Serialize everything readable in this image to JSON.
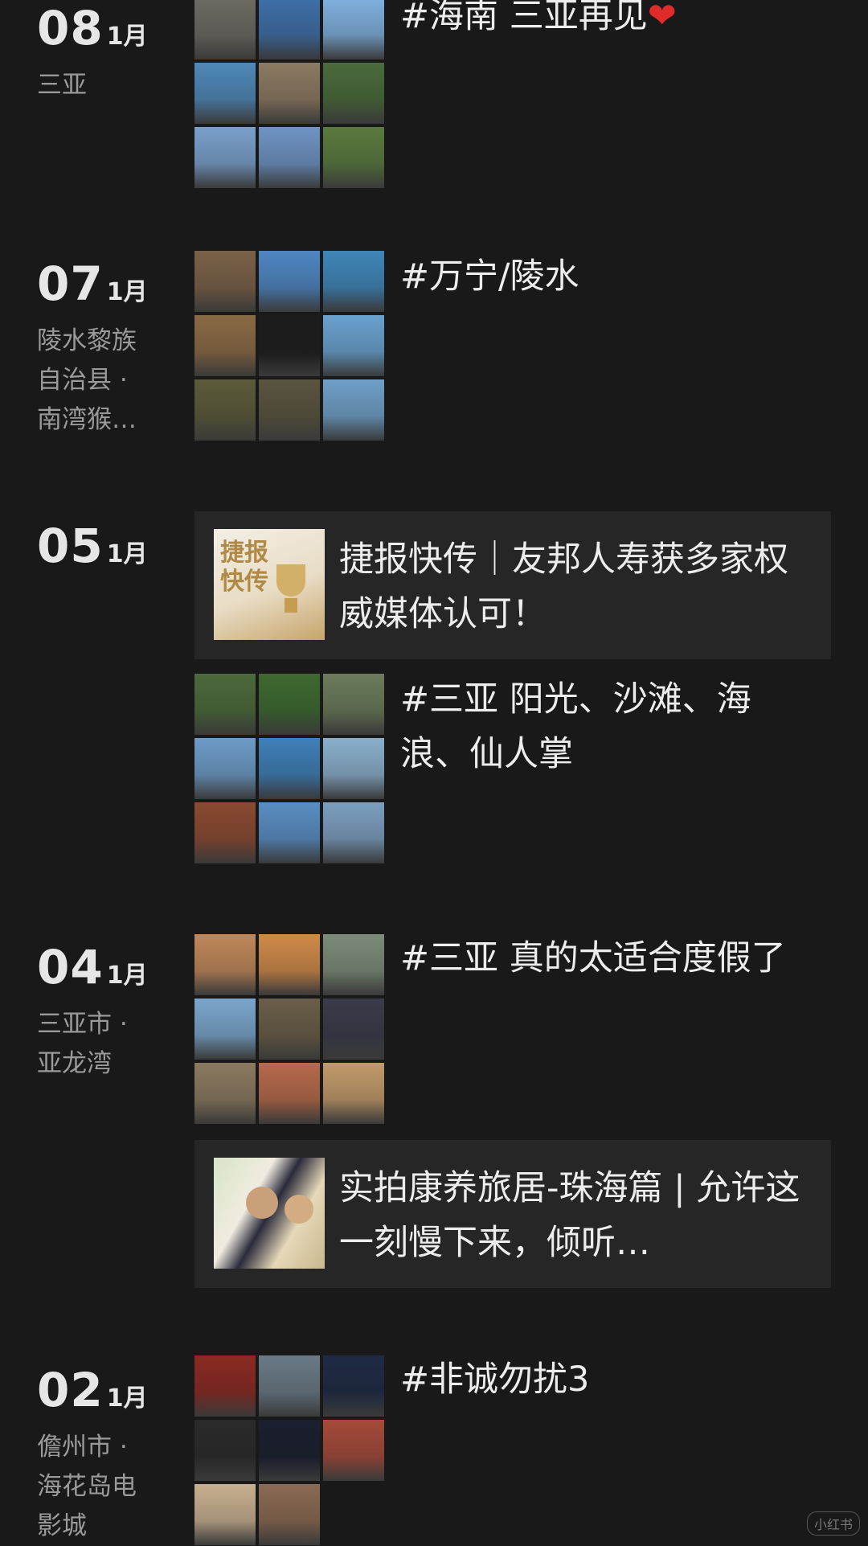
{
  "colors": {
    "background": "#191919",
    "card": "#262626",
    "text": "#ededed",
    "muted": "#9a9a9a",
    "heart": "#e02b2b"
  },
  "entries": [
    {
      "day": "08",
      "month": "1月",
      "location": "三亚",
      "caption": "#海南 三亚再见",
      "heart": "❤"
    },
    {
      "day": "07",
      "month": "1月",
      "location": "陵水黎族自治县 · 南湾猴…",
      "caption": "#万宁/陵水"
    },
    {
      "day": "05",
      "month": "1月",
      "location": "",
      "link_title": "捷报快传｜友邦人寿获多家权威媒体认可！",
      "link_thumb_text": "捷报快传",
      "caption": "#三亚 阳光、沙滩、海浪、仙人掌"
    },
    {
      "day": "04",
      "month": "1月",
      "location": "三亚市 · 亚龙湾",
      "caption": "#三亚 真的太适合度假了",
      "link_title": "实拍康养旅居-珠海篇 | 允许这一刻慢下来，倾听…"
    },
    {
      "day": "02",
      "month": "1月",
      "location": "儋州市 · 海花岛电影城",
      "caption": "#非诚勿扰3"
    }
  ],
  "grid_colors": [
    [
      "#6d6a63",
      "#3f6fa8",
      "#7fb0de",
      "#4f88b8",
      "#8c7a62",
      "#4a6b3a",
      "#7aa0cc",
      "#6f94c4",
      "#5a7a3f"
    ],
    [
      "#7a6148",
      "#4f86c2",
      "#3f86b8",
      "#8a6a45",
      "#1c1c1c",
      "#6aa2cf",
      "#5b5a3a",
      "#5a5540",
      "#6fa0c8"
    ],
    [
      "#4c6a3a",
      "#3d6a30",
      "#6b7b5a",
      "#6d9cc8",
      "#3f7fb8",
      "#8ab0cc",
      "#8a4a32",
      "#5a8ec4",
      "#7c9fc0"
    ],
    [
      "#c0885a",
      "#d08a4a",
      "#7d8c7a",
      "#7aa6cc",
      "#6a5e48",
      "#3a3a4a",
      "#8a7a60",
      "#b66a4a",
      "#c29a6a"
    ],
    [
      "#8a2a22",
      "#6a7a86",
      "#1e2a44",
      "#2a2a2a",
      "#1a1e2e",
      "#a44a3a",
      "#c8b090",
      "#8a6a52"
    ]
  ],
  "watermark": "小红书"
}
